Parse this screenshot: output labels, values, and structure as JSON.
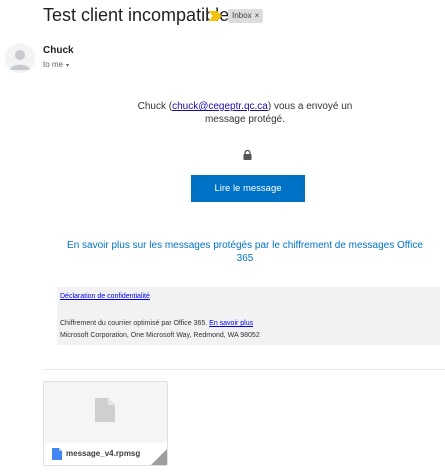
{
  "email": {
    "subject": "Test client incompatible",
    "label": "Inbox",
    "label_close": "×",
    "sender_name": "Chuck",
    "recipient": "to me",
    "recipient_caret": "▾"
  },
  "body": {
    "intro_prefix": "Chuck (",
    "sender_email": "chuck@cegeptr.qc.ca",
    "intro_suffix": ") vous a envoyé un message protégé.",
    "read_button": "Lire le message",
    "learn_more": "En savoir plus sur les messages protégés par le chiffrement de messages Office 365",
    "privacy_link": "Déclaration de confidentialité",
    "footer_line1": "Chiffrement du courrier optimisé par Office 365.",
    "footer_link": "En savoir plus",
    "footer_line2": "Microsoft Corporation, One Microsoft Way, Redmond, WA 98052"
  },
  "attachment": {
    "filename": "message_v4.rpmsg"
  },
  "icons": {
    "important": "important-marker-icon",
    "avatar": "default-avatar-icon",
    "lock": "lock-icon",
    "document": "document-icon",
    "file": "file-icon"
  },
  "colors": {
    "button": "#0072c6",
    "link": "#0072c6",
    "important": "#f4c20d",
    "footer_bg": "#f2f2f2"
  }
}
